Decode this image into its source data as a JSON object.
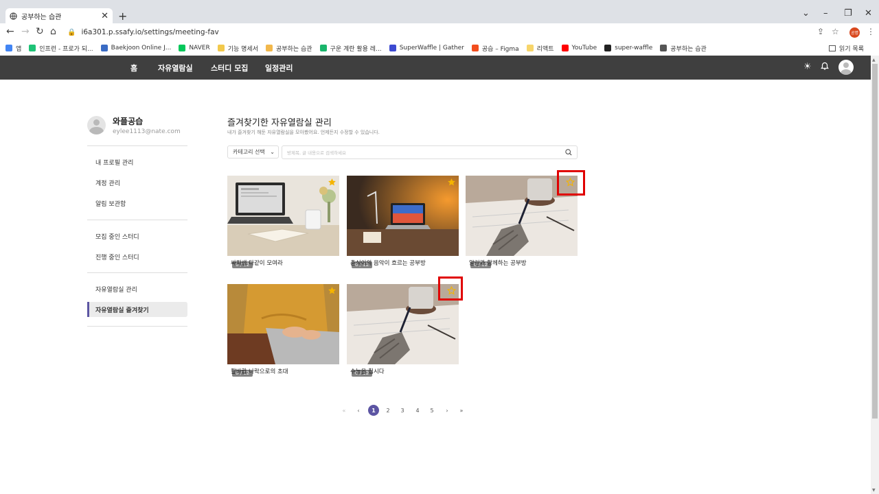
{
  "browser": {
    "tab_title": "공부하는 습관",
    "close": "✕",
    "new_tab": "+",
    "url": "i6a301.p.ssafy.io/settings/meeting-fav",
    "bookmarks": [
      {
        "label": "앱",
        "color": "#4285f4"
      },
      {
        "label": "인프런 - 프로가 되...",
        "color": "#1ec276"
      },
      {
        "label": "Baekjoon Online J...",
        "color": "#3a6bc4"
      },
      {
        "label": "NAVER",
        "color": "#03c75a"
      },
      {
        "label": "기능 명세서",
        "color": "#f2c94c"
      },
      {
        "label": "공부하는 습관",
        "color": "#f2b84c"
      },
      {
        "label": "구운 계란 활용 레...",
        "color": "#19b56b"
      },
      {
        "label": "SuperWaffle | Gather",
        "color": "#3d4ad1"
      },
      {
        "label": "공습 – Figma",
        "color": "#f24e1e"
      },
      {
        "label": "리액트",
        "color": "#f7d56a"
      },
      {
        "label": "YouTube",
        "color": "#ff0000"
      },
      {
        "label": "super-waffle",
        "color": "#222222"
      },
      {
        "label": "공부하는 습관",
        "color": "#555555"
      }
    ],
    "reading_list": "읽기 목록",
    "profile_initial": "공명"
  },
  "header": {
    "nav": [
      "홈",
      "자유열람실",
      "스터디 모집",
      "일정관리"
    ]
  },
  "sidebar": {
    "name": "와플공습",
    "email": "eylee1113@nate.com",
    "groups": [
      [
        "내 프로필 관리",
        "계정 관리",
        "알림 보관함"
      ],
      [
        "모집 중인 스터디",
        "진행 중인 스터디"
      ],
      [
        "자유열람실 관리",
        "자유열람실 즐겨찾기"
      ]
    ],
    "active": "자유열람실 즐겨찾기"
  },
  "main": {
    "title": "즐겨찾기한 자유열람실 관리",
    "subtitle": "내가 즐겨찾기 해둔 자유열람실을 모아봤어요. 언제든지 수정할 수 있습니다.",
    "category_select": "카테고리 선택",
    "search_placeholder": "방제목, 글 내용으로 검색하세요",
    "cards": [
      {
        "title": "싸피생 다같이 모여라",
        "count": "0 / 12",
        "favorite": true
      },
      {
        "title": "춘식이의 음악이 흐르는 공부방",
        "count": "0 / 12",
        "favorite": true
      },
      {
        "title": "알린과 함께하는 공부방",
        "count": "0 / 12",
        "favorite": false
      },
      {
        "title": "칼바람 나락으로의 초대",
        "count": "0 / 12",
        "favorite": true
      },
      {
        "title": "수능을 칩시다",
        "count": "0 / 12",
        "favorite": false
      }
    ]
  },
  "pagination": {
    "first": "«",
    "prev": "‹",
    "pages": [
      "1",
      "2",
      "3",
      "4",
      "5"
    ],
    "next": "›",
    "last": "»",
    "current": "1"
  },
  "colors": {
    "accent": "#5c55a3",
    "appbar": "#3f3f3f",
    "star": "#f5b400",
    "highlight": "#e00000"
  }
}
